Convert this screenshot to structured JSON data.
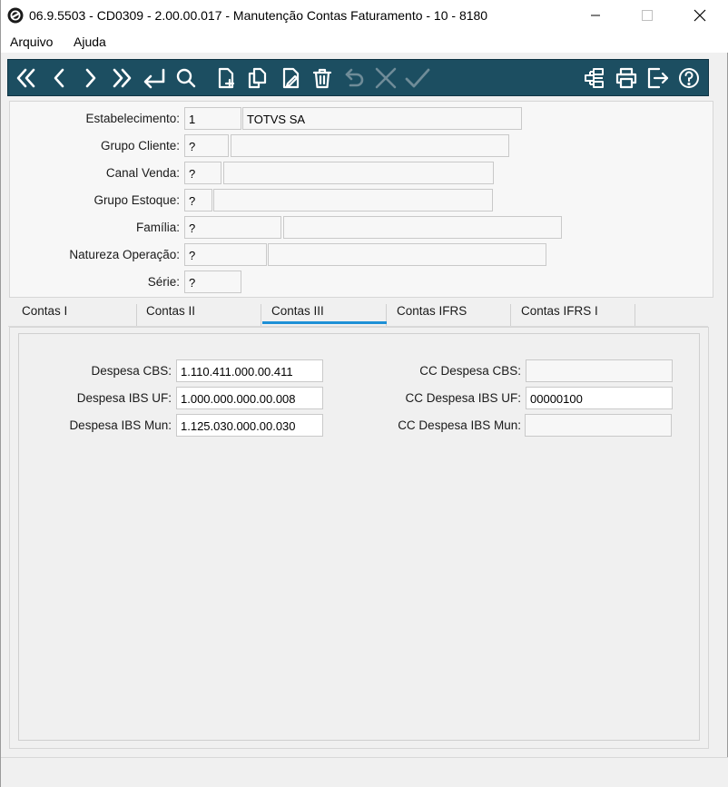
{
  "window": {
    "title": "06.9.5503 - CD0309 - 2.00.00.017 - Manutenção Contas Faturamento - 10 - 8180"
  },
  "menu": {
    "items": [
      "Arquivo",
      "Ajuda"
    ]
  },
  "toolbar": {
    "left_icons": [
      "first-icon",
      "previous-icon",
      "next-icon",
      "last-icon",
      "goto-icon",
      "search-icon",
      "new-icon",
      "copy-icon",
      "edit-icon",
      "delete-icon",
      "undo-icon",
      "cancel-icon",
      "confirm-icon"
    ],
    "right_icons": [
      "structure-icon",
      "print-icon",
      "exit-icon",
      "help-icon"
    ],
    "disabled": [
      "undo-icon",
      "cancel-icon",
      "confirm-icon"
    ]
  },
  "header": {
    "estabelecimento": {
      "label": "Estabelecimento:",
      "code": "1",
      "description": "TOTVS SA"
    },
    "grupo_cliente": {
      "label": "Grupo Cliente:",
      "code": "?",
      "description": ""
    },
    "canal_venda": {
      "label": "Canal Venda:",
      "code": "?",
      "description": ""
    },
    "grupo_estoque": {
      "label": "Grupo Estoque:",
      "code": "?",
      "description": ""
    },
    "familia": {
      "label": "Família:",
      "code": "?",
      "description": ""
    },
    "natureza_operacao": {
      "label": "Natureza Operação:",
      "code": "?",
      "description": ""
    },
    "serie": {
      "label": "Série:",
      "code": "?"
    }
  },
  "tabs": {
    "items": [
      "Contas I",
      "Contas II",
      "Contas III",
      "Contas IFRS",
      "Contas IFRS I"
    ],
    "active": "Contas III"
  },
  "contas_iii": {
    "despesa_cbs": {
      "label": "Despesa CBS:",
      "value": "1.110.411.000.00.411"
    },
    "despesa_ibs_uf": {
      "label": "Despesa IBS UF:",
      "value": "1.000.000.000.00.008"
    },
    "despesa_ibs_mun": {
      "label": "Despesa IBS Mun:",
      "value": "1.125.030.000.00.030"
    },
    "cc_despesa_cbs": {
      "label": "CC Despesa CBS:",
      "value": ""
    },
    "cc_despesa_ibs_uf": {
      "label": "CC Despesa IBS UF:",
      "value": "00000100"
    },
    "cc_despesa_ibs_mun": {
      "label": "CC Despesa IBS Mun:",
      "value": ""
    }
  },
  "colors": {
    "toolbar": "#1c4e61",
    "toolbar_icon": "#ffffff",
    "toolbar_icon_disabled": "#6f8c98",
    "active_tab": "#1e90d6"
  }
}
